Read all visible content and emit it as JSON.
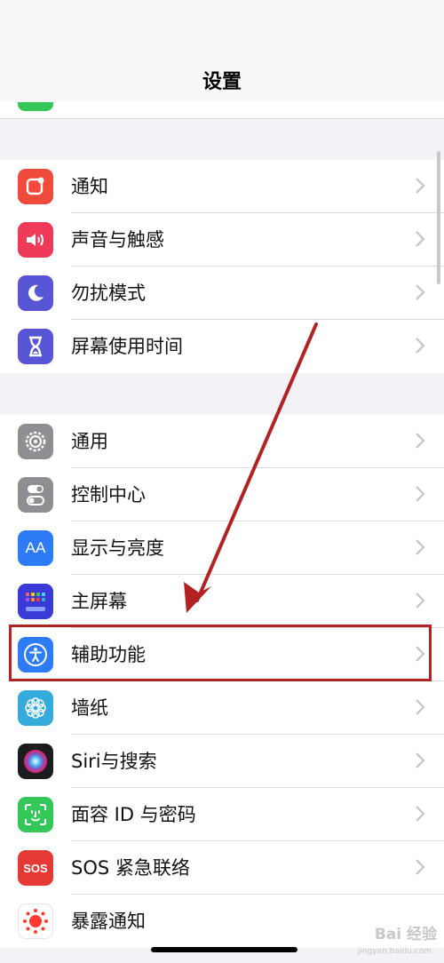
{
  "header": {
    "title": "设置"
  },
  "groups": [
    {
      "items": [
        {
          "label": "通知",
          "icon": "notifications-icon",
          "color": "#f04a3c"
        },
        {
          "label": "声音与触感",
          "icon": "speaker-icon",
          "color": "#f03a5a"
        },
        {
          "label": "勿扰模式",
          "icon": "moon-icon",
          "color": "#5856d6"
        },
        {
          "label": "屏幕使用时间",
          "icon": "hourglass-icon",
          "color": "#5856d6"
        }
      ]
    },
    {
      "items": [
        {
          "label": "通用",
          "icon": "gear-icon",
          "color": "#8e8e93"
        },
        {
          "label": "控制中心",
          "icon": "toggles-icon",
          "color": "#8e8e93"
        },
        {
          "label": "显示与亮度",
          "icon": "aa-icon",
          "glyph": "AA",
          "color": "#2d7cf6"
        },
        {
          "label": "主屏幕",
          "icon": "home-screen-icon",
          "color": "#3a3ad6"
        },
        {
          "label": "辅助功能",
          "icon": "accessibility-icon",
          "color": "#2d7cf6"
        },
        {
          "label": "墙纸",
          "icon": "flower-icon",
          "color": "#35aadc"
        },
        {
          "label": "Siri与搜索",
          "icon": "siri-icon",
          "color": "#1c1c1e"
        },
        {
          "label": "面容 ID 与密码",
          "icon": "face-id-icon",
          "color": "#34c759"
        },
        {
          "label": "SOS 紧急联络",
          "icon": "sos-icon",
          "glyph": "SOS",
          "color": "#e53935"
        },
        {
          "label": "暴露通知",
          "icon": "exposure-icon",
          "color": "#ffffff"
        }
      ]
    }
  ],
  "annotation": {
    "highlighted_item": "辅助功能",
    "arrow_color": "#b22222"
  },
  "watermark": {
    "text": "Bai 经验",
    "sub": "jingyan.baidu.com"
  }
}
